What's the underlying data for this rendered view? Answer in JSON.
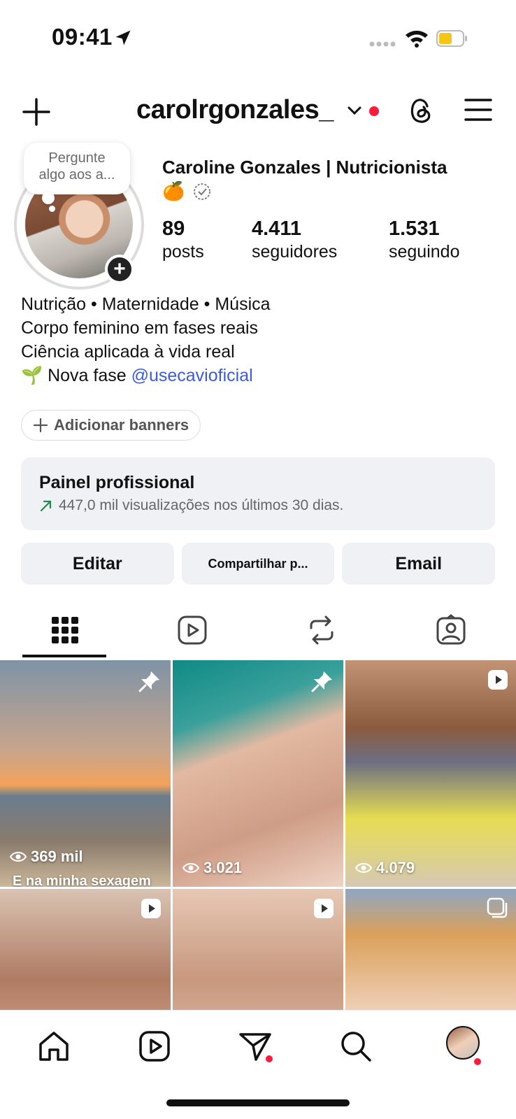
{
  "status_bar": {
    "time": "09:41"
  },
  "header": {
    "username": "carolrgonzales_"
  },
  "note": {
    "text_line1": "Pergunte",
    "text_line2": "algo aos a..."
  },
  "profile": {
    "full_name": "Caroline Gonzales | Nutricionista",
    "emoji": "🍊",
    "stats": [
      {
        "value": "89",
        "label": "posts"
      },
      {
        "value": "4.411",
        "label": "seguidores"
      },
      {
        "value": "1.531",
        "label": "seguindo"
      }
    ],
    "bio": {
      "line1": "Nutrição • Maternidade • Música",
      "line2": "Corpo feminino em fases reais",
      "line3": "Ciência aplicada à vida real",
      "line4_emoji": "🌱",
      "line4_text": " Nova fase ",
      "line4_mention": "@usecavioficial"
    }
  },
  "banner_button": "Adicionar banners",
  "professional_panel": {
    "title": "Painel profissional",
    "subtitle": "447,0 mil visualizações nos últimos 30 dias."
  },
  "actions": {
    "edit": "Editar",
    "share": "Compartilhar p...",
    "email": "Email"
  },
  "grid": [
    {
      "views": "369 mil",
      "caption": "E na minha sexagem",
      "badge": "pin-icon"
    },
    {
      "views": "3.021",
      "badge": "pin-icon"
    },
    {
      "views": "4.079",
      "badge": "reel-icon"
    },
    {
      "badge": "reel-icon"
    },
    {
      "badge": "reel-icon"
    },
    {
      "badge": "carousel-icon"
    }
  ],
  "colors": {
    "accent_red": "#ff1a3c",
    "link_blue": "#3b5bdb",
    "panel_bg": "#eff1f4"
  }
}
